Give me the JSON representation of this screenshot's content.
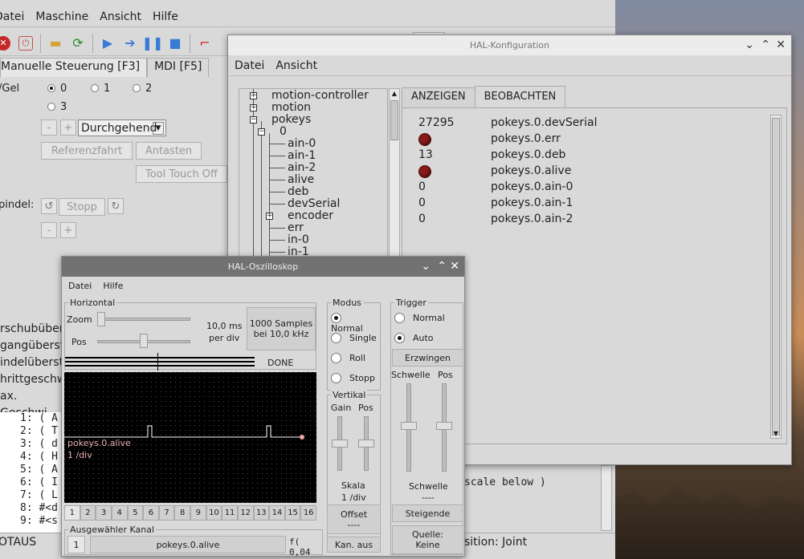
{
  "main": {
    "menu": [
      "Datei",
      "Maschine",
      "Ansicht",
      "Hilfe"
    ],
    "tabs": [
      "Manuelle Steuerung [F3]",
      "MDI [F5]"
    ],
    "jog_label": "/Gel",
    "jog_options": [
      "0",
      "1",
      "2",
      "3"
    ],
    "minus": "-",
    "plus": "+",
    "jog_mode": "Durchgehend",
    "home_button": "Referenzfahrt",
    "touch_button": "Antasten",
    "tool_touch_button": "Tool Touch Off",
    "spindle_label": "pindel:",
    "spindle_stop": "Stopp",
    "side_labels": [
      "rschubübers",
      "gangüberste",
      "indelüberste",
      "hrittgeschw",
      "ax. Geschwi"
    ],
    "code_lines": [
      "1: ( A",
      "2: ( T",
      "3: ( d",
      "4: ( H",
      "5: ( A",
      "6: ( I",
      "7: ( L",
      "8: #<d",
      "9: #<s"
    ],
    "right_code": "scale below )",
    "status_left": "OTAUS",
    "status_right": "sition: Joint"
  },
  "hal": {
    "title": "HAL-Konfiguration",
    "menu": [
      "Datei",
      "Ansicht"
    ],
    "tree": [
      "motion-controller",
      "motion",
      "pokeys",
      "0",
      "ain-0",
      "ain-1",
      "ain-2",
      "alive",
      "deb",
      "devSerial",
      "encoder",
      "err",
      "in-0",
      "in-1"
    ],
    "tabs": [
      "ANZEIGEN",
      "BEOBACHTEN"
    ],
    "watch": [
      {
        "value": "27295",
        "name": "pokeys.0.devSerial"
      },
      {
        "value": "",
        "led": true,
        "name": "pokeys.0.err"
      },
      {
        "value": "13",
        "name": "pokeys.0.deb"
      },
      {
        "value": "",
        "led": true,
        "name": "pokeys.0.alive"
      },
      {
        "value": "0",
        "name": "pokeys.0.ain-0"
      },
      {
        "value": "0",
        "name": "pokeys.0.ain-1"
      },
      {
        "value": "0",
        "name": "pokeys.0.ain-2"
      }
    ],
    "led_color": "#8a1a1a"
  },
  "osc": {
    "title": "HAL-Oszilloskop",
    "menu": [
      "Datei",
      "Hilfe"
    ],
    "horizontal": {
      "title": "Horizontal",
      "zoom_label": "Zoom",
      "pos_label": "Pos",
      "time_per_div": "10,0 ms",
      "per_div": "per div",
      "samples": "1000 Samples",
      "rate": "bei 10,0 kHz",
      "status": "DONE"
    },
    "modus": {
      "title": "Modus",
      "options": [
        "Normal",
        "Single",
        "Roll",
        "Stopp"
      ],
      "selected": 0
    },
    "vertikal": {
      "title": "Vertikal",
      "gain_label": "Gain",
      "pos_label": "Pos",
      "scale_label": "Skala",
      "scale_value": "1 /div",
      "offset_button": "Offset",
      "offset_value": "----",
      "channel_off_button": "Kan. aus"
    },
    "trigger": {
      "title": "Trigger",
      "options": [
        "Normal",
        "Auto"
      ],
      "selected": 1,
      "force_button": "Erzwingen",
      "level_label": "Schwelle",
      "pos_label": "Pos",
      "level_caption": "Schwelle",
      "level_value": "----",
      "edge_button": "Steigende",
      "source_button": "Quelle:",
      "source_value": "Keine"
    },
    "trace_label": "pokeys.0.alive",
    "trace_scale": "1 /div",
    "trace_color": "#ffffff",
    "channels": [
      "1",
      "2",
      "3",
      "4",
      "5",
      "6",
      "7",
      "8",
      "9",
      "10",
      "11",
      "12",
      "13",
      "14",
      "15",
      "16"
    ],
    "selected_channel_title": "Ausgewähler Kanal",
    "selected_channel_num": "1",
    "selected_channel_name": "pokeys.0.alive",
    "formula": "f( 0,04"
  }
}
